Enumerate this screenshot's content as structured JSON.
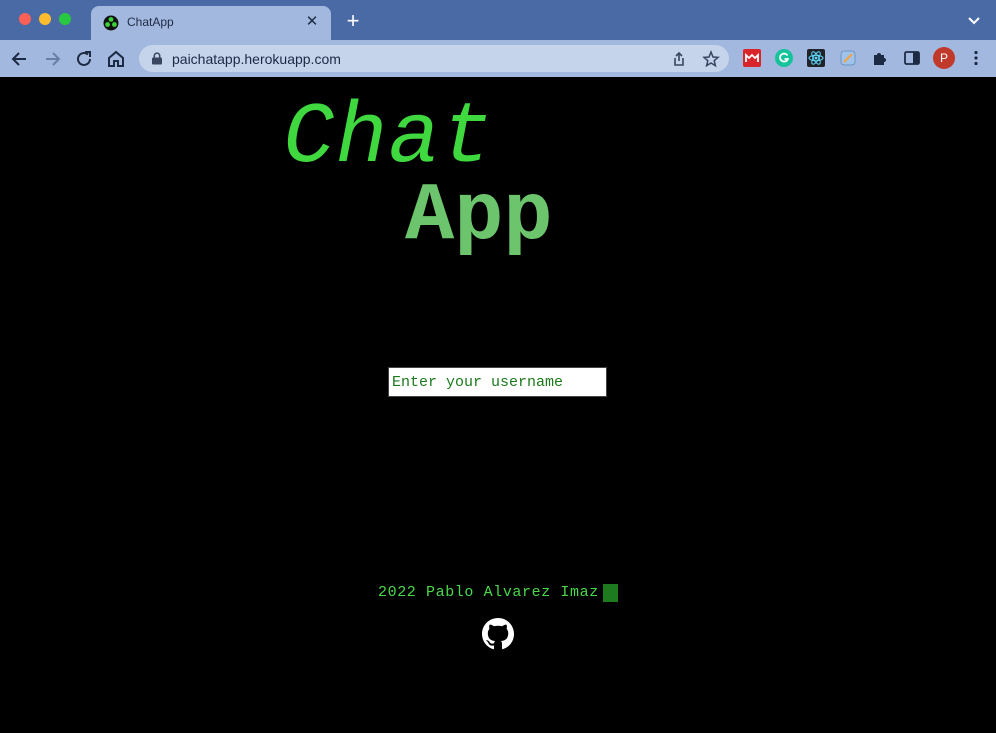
{
  "browser": {
    "tab": {
      "title": "ChatApp",
      "favicon": "chatapp-favicon-icon"
    },
    "url": "paichatapp.herokuapp.com",
    "avatar_letter": "P"
  },
  "page": {
    "logo": {
      "line1": "Chat",
      "line2": "App"
    },
    "username_input": {
      "placeholder": "Enter your username",
      "value": ""
    },
    "footer": {
      "text": "2022 Pablo Alvarez Imaz"
    },
    "github_icon": "github-icon"
  },
  "colors": {
    "background": "#000000",
    "logo_chat": "#3fd83f",
    "logo_app": "#6cc46c",
    "accent_green": "#1b7a1b"
  }
}
